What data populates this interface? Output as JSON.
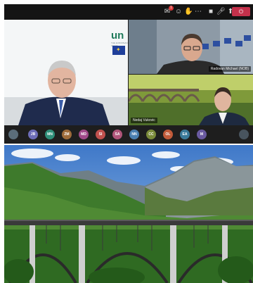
{
  "toolbar": {
    "icons": [
      "chat-icon",
      "people-icon",
      "hand-icon",
      "more-icon",
      "camera-icon",
      "mic-icon",
      "share-icon"
    ],
    "badge": "1",
    "leave_label": "⏻"
  },
  "tiles": {
    "main": {
      "slide_title": "un",
      "slide_subtitle": "THE EUROPEAN UNION"
    },
    "top_right": {
      "name": "Radovan Michael (NOB)"
    },
    "bottom_right": {
      "name": "Nedaj Vukovic"
    }
  },
  "participants": [
    {
      "initials": "",
      "color": "#5b6d7a"
    },
    {
      "initials": "JB",
      "color": "#6d6db8"
    },
    {
      "initials": "MN",
      "color": "#2f8f7a"
    },
    {
      "initials": "ZM",
      "color": "#9e6b3a"
    },
    {
      "initials": "MD",
      "color": "#a04a8a"
    },
    {
      "initials": "SI",
      "color": "#c0504d"
    },
    {
      "initials": "SA",
      "color": "#b0557a"
    },
    {
      "initials": "NN",
      "color": "#4a7fb0"
    },
    {
      "initials": "CC",
      "color": "#7a8a3a"
    },
    {
      "initials": "OL",
      "color": "#c25b3a"
    },
    {
      "initials": "EA",
      "color": "#3a7a9a"
    },
    {
      "initials": "M",
      "color": "#6a5aa0"
    },
    {
      "initials": "",
      "color": "#48545e"
    }
  ]
}
